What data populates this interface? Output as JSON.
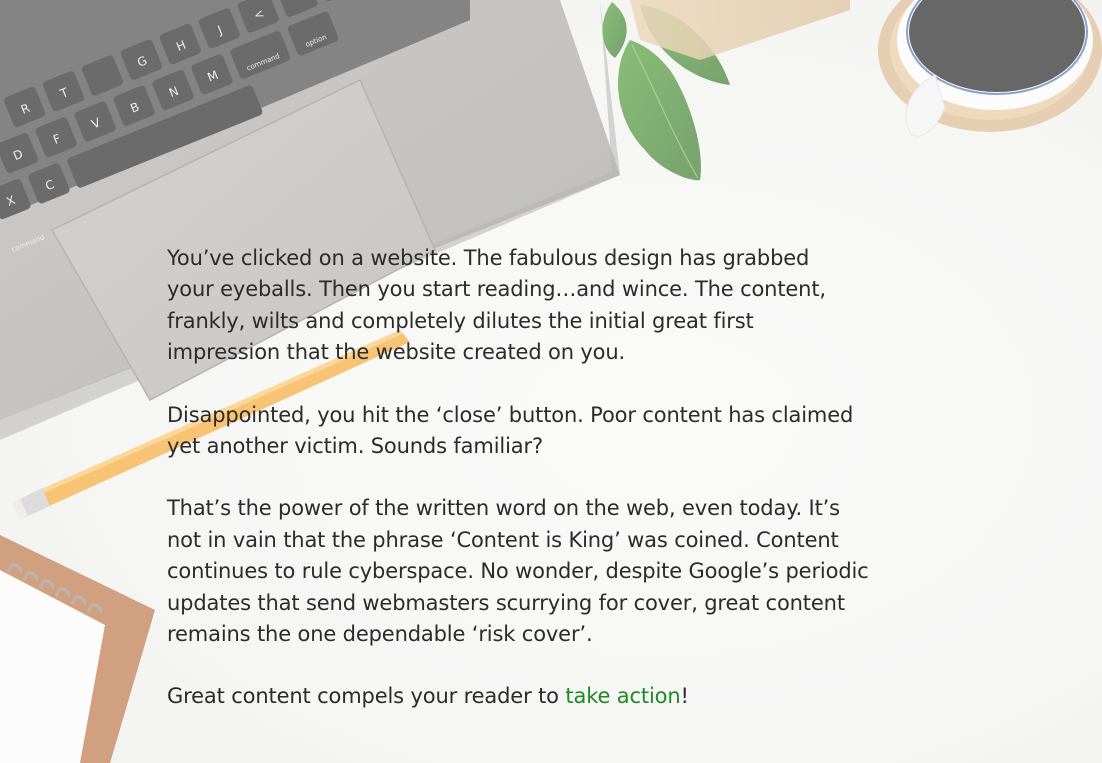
{
  "paragraphs": [
    {
      "lines": [
        "You’ve clicked on a website. The fabulous design has grabbed",
        "your eyeballs. Then you start reading…and wince. The content,",
        "frankly, wilts and completely dilutes the initial great first",
        "impression that the website created on you."
      ]
    },
    {
      "lines": [
        "Disappointed, you hit the ‘close’ button. Poor content has claimed",
        "yet another victim. Sounds familiar?"
      ]
    },
    {
      "lines": [
        "That’s the power of the written word on the web, even today. It’s",
        "not in vain that the phrase ‘Content is King’ was coined. Content",
        "continues to rule cyberspace. No wonder, despite Google’s periodic",
        "updates that send webmasters scurrying for cover, great content",
        "remains the one dependable ‘risk cover’."
      ]
    },
    {
      "before": "Great content compels your reader to ",
      "highlight": "take action",
      "after": "!"
    }
  ],
  "keyboard": {
    "keys": [
      "R",
      "T",
      "G",
      "H",
      "J",
      "<",
      "D",
      "F",
      "V",
      "B",
      "N",
      "M",
      "X",
      "C",
      "command",
      "option",
      "command"
    ]
  },
  "colors": {
    "text": "#2b2b2b",
    "accent": "#1f8a1f",
    "laptop": "#a6a4a1",
    "pencil": "#f4a42a"
  }
}
